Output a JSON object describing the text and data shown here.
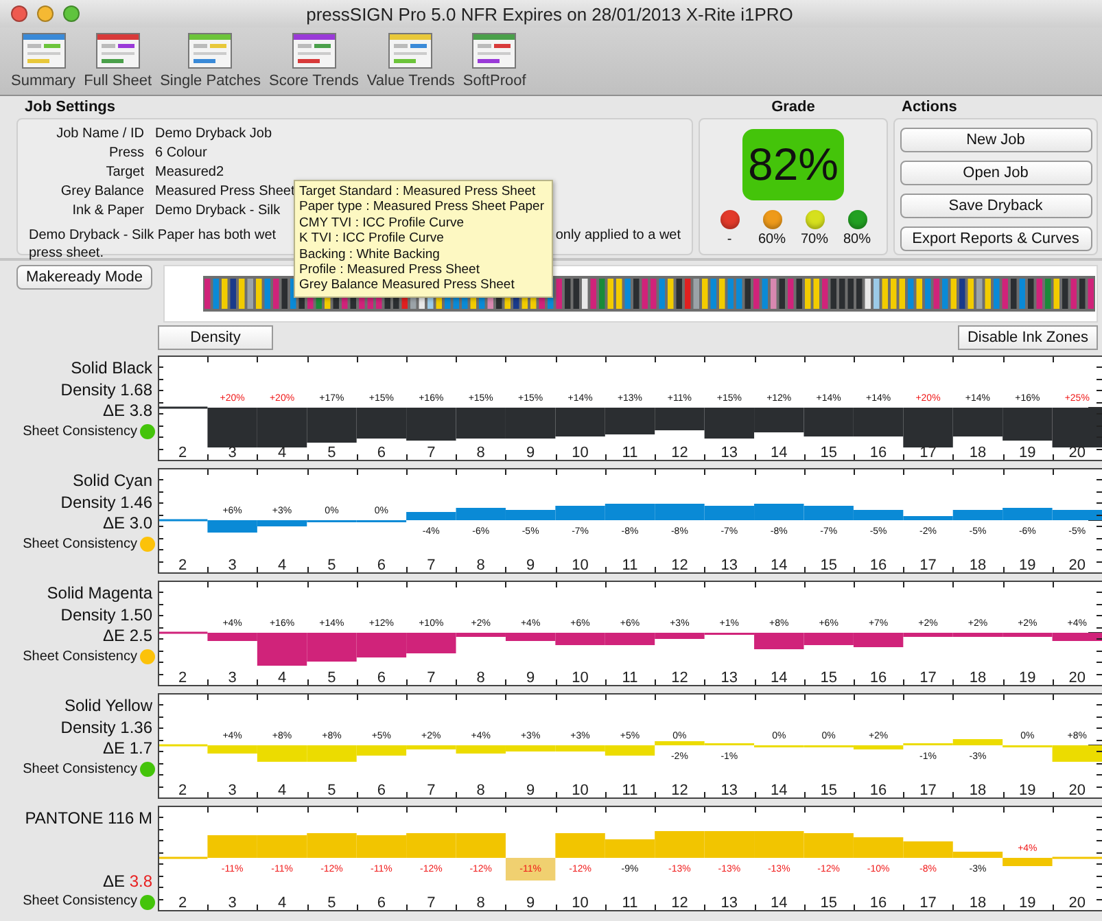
{
  "window": {
    "title": "pressSIGN Pro 5.0 NFR Expires on 28/01/2013 X-Rite i1PRO"
  },
  "toolbar": [
    {
      "label": "Summary"
    },
    {
      "label": "Full Sheet"
    },
    {
      "label": "Single Patches"
    },
    {
      "label": "Score Trends"
    },
    {
      "label": "Value Trends"
    },
    {
      "label": "SoftProof"
    }
  ],
  "job_settings": {
    "title": "Job Settings",
    "fields": [
      {
        "label": "Job Name / ID",
        "value": "Demo Dryback Job"
      },
      {
        "label": "Press",
        "value": "6 Colour"
      },
      {
        "label": "Target",
        "value": "Measured2"
      },
      {
        "label": "Grey Balance",
        "value": "Measured Press Sheet"
      },
      {
        "label": "Ink & Paper",
        "value": "Demo Dryback - Silk"
      }
    ],
    "note_start": "Demo Dryback - Silk Paper has both wet",
    "note_end": "only applied to a wet",
    "note_line2": "press sheet."
  },
  "tooltip": {
    "lines": [
      "Target Standard : Measured Press Sheet",
      "Paper type : Measured Press Sheet Paper",
      "CMY TVI : ICC Profile Curve",
      "K TVI : ICC Profile Curve",
      "Backing : White Backing",
      "Profile : Measured Press Sheet",
      "Grey Balance Measured Press Sheet"
    ]
  },
  "grade": {
    "title": "Grade",
    "score": "82%",
    "levels": [
      {
        "label": "-",
        "color": "#e23a2a"
      },
      {
        "label": "60%",
        "color": "#ee9a1a"
      },
      {
        "label": "70%",
        "color": "#d6e01e"
      },
      {
        "label": "80%",
        "color": "#22a022"
      }
    ]
  },
  "actions": {
    "title": "Actions",
    "buttons": [
      "New Job",
      "Open Job",
      "Save Dryback",
      "Export Reports & Curves"
    ]
  },
  "makeready_button": "Makeready Mode",
  "density_button": "Density",
  "ink_zones_button": "Disable Ink Zones",
  "charts": [
    {
      "name": "Solid Black",
      "density": "Density 1.68",
      "delta_e_label": "ΔE",
      "delta_e": "3.8",
      "delta_e_alert": false,
      "consistency": {
        "label": "Sheet Consistency",
        "color": "#44c40a"
      },
      "color": "#2b2e31",
      "axis": [
        "2",
        "3",
        "4",
        "5",
        "6",
        "7",
        "8",
        "9",
        "10",
        "11",
        "12",
        "13",
        "14",
        "15",
        "16",
        "17",
        "18",
        "19",
        "20"
      ],
      "bars": [
        {
          "above": "+20%",
          "alert": true
        },
        {
          "above": "+20%",
          "alert": true
        },
        {
          "above": "+17%",
          "alert": false
        },
        {
          "above": "+15%",
          "alert": false
        },
        {
          "above": "+16%",
          "alert": false
        },
        {
          "above": "+15%",
          "alert": false
        },
        {
          "above": "+15%",
          "alert": false
        },
        {
          "above": "+14%",
          "alert": false
        },
        {
          "above": "+13%",
          "alert": false
        },
        {
          "above": "+11%",
          "alert": false
        },
        {
          "above": "+15%",
          "alert": false
        },
        {
          "above": "+12%",
          "alert": false
        },
        {
          "above": "+14%",
          "alert": false
        },
        {
          "above": "+14%",
          "alert": false
        },
        {
          "above": "+20%",
          "alert": true
        },
        {
          "above": "+14%",
          "alert": false
        },
        {
          "above": "+16%",
          "alert": false
        },
        {
          "above": "+25%",
          "alert": true
        }
      ]
    },
    {
      "name": "Solid Cyan",
      "density": "Density 1.46",
      "delta_e_label": "ΔE",
      "delta_e": "3.0",
      "delta_e_alert": false,
      "consistency": {
        "label": "Sheet Consistency",
        "color": "#fcc20a"
      },
      "color": "#0a8ad6",
      "axis": [
        "2",
        "3",
        "4",
        "5",
        "6",
        "7",
        "8",
        "9",
        "10",
        "11",
        "12",
        "13",
        "14",
        "15",
        "16",
        "17",
        "18",
        "19",
        "20"
      ],
      "bars": [
        {
          "above": "+6%",
          "alert": false
        },
        {
          "above": "+3%",
          "alert": false
        },
        {
          "above": "0%",
          "alert": false
        },
        {
          "above": "0%",
          "alert": false
        },
        {
          "below": "-4%",
          "alert": false
        },
        {
          "below": "-6%",
          "alert": false
        },
        {
          "below": "-5%",
          "alert": false
        },
        {
          "below": "-7%",
          "alert": false
        },
        {
          "below": "-8%",
          "alert": false
        },
        {
          "below": "-8%",
          "alert": false
        },
        {
          "below": "-7%",
          "alert": false
        },
        {
          "below": "-8%",
          "alert": false
        },
        {
          "below": "-7%",
          "alert": false
        },
        {
          "below": "-5%",
          "alert": false
        },
        {
          "below": "-2%",
          "alert": false
        },
        {
          "below": "-5%",
          "alert": false
        },
        {
          "below": "-6%",
          "alert": false
        },
        {
          "below": "-5%",
          "alert": false
        }
      ]
    },
    {
      "name": "Solid Magenta",
      "density": "Density 1.50",
      "delta_e_label": "ΔE",
      "delta_e": "2.5",
      "delta_e_alert": false,
      "consistency": {
        "label": "Sheet Consistency",
        "color": "#fcc20a"
      },
      "color": "#d0237a",
      "axis": [
        "2",
        "3",
        "4",
        "5",
        "6",
        "7",
        "8",
        "9",
        "10",
        "11",
        "12",
        "13",
        "14",
        "15",
        "16",
        "17",
        "18",
        "19",
        "20"
      ],
      "bars": [
        {
          "above": "+4%",
          "alert": false
        },
        {
          "above": "+16%",
          "alert": false
        },
        {
          "above": "+14%",
          "alert": false
        },
        {
          "above": "+12%",
          "alert": false
        },
        {
          "above": "+10%",
          "alert": false
        },
        {
          "above": "+2%",
          "alert": false
        },
        {
          "above": "+4%",
          "alert": false
        },
        {
          "above": "+6%",
          "alert": false
        },
        {
          "above": "+6%",
          "alert": false
        },
        {
          "above": "+3%",
          "alert": false
        },
        {
          "above": "+1%",
          "alert": false
        },
        {
          "above": "+8%",
          "alert": false
        },
        {
          "above": "+6%",
          "alert": false
        },
        {
          "above": "+7%",
          "alert": false
        },
        {
          "above": "+2%",
          "alert": false
        },
        {
          "above": "+2%",
          "alert": false
        },
        {
          "above": "+2%",
          "alert": false
        },
        {
          "above": "+4%",
          "alert": false
        }
      ]
    },
    {
      "name": "Solid Yellow",
      "density": "Density 1.36",
      "delta_e_label": "ΔE",
      "delta_e": "1.7",
      "delta_e_alert": false,
      "consistency": {
        "label": "Sheet Consistency",
        "color": "#44c40a"
      },
      "color": "#ecdc00",
      "axis": [
        "2",
        "3",
        "4",
        "5",
        "6",
        "7",
        "8",
        "9",
        "10",
        "11",
        "12",
        "13",
        "14",
        "15",
        "16",
        "17",
        "18",
        "19",
        "20"
      ],
      "bars": [
        {
          "above": "+4%",
          "alert": false
        },
        {
          "above": "+8%",
          "alert": false
        },
        {
          "above": "+8%",
          "alert": false
        },
        {
          "above": "+5%",
          "alert": false
        },
        {
          "above": "+2%",
          "alert": false
        },
        {
          "above": "+4%",
          "alert": false
        },
        {
          "above": "+3%",
          "alert": false
        },
        {
          "above": "+3%",
          "alert": false
        },
        {
          "above": "+5%",
          "alert": false
        },
        {
          "above": "0%",
          "below": "-2%",
          "alert": false
        },
        {
          "below": "-1%",
          "alert": false
        },
        {
          "above": "0%",
          "alert": false
        },
        {
          "above": "0%",
          "alert": false
        },
        {
          "above": "+2%",
          "alert": false
        },
        {
          "below": "-1%",
          "alert": false
        },
        {
          "below": "-3%",
          "alert": false
        },
        {
          "above": "0%",
          "alert": false
        },
        {
          "above": "+8%",
          "alert": false
        }
      ]
    },
    {
      "name": "PANTONE 116 M",
      "delta_e_label": "ΔE",
      "delta_e": "3.8",
      "delta_e_alert": true,
      "consistency": {
        "label": "Sheet Consistency",
        "color": "#44c40a"
      },
      "color": "#f2c500",
      "axis": [
        "2",
        "3",
        "4",
        "5",
        "6",
        "7",
        "8",
        "9",
        "10",
        "11",
        "12",
        "13",
        "14",
        "15",
        "16",
        "17",
        "18",
        "19",
        "20"
      ],
      "bars": [
        {
          "below": "-11%",
          "alert": true,
          "highlighted": false
        },
        {
          "below": "-11%",
          "alert": true,
          "highlighted": false
        },
        {
          "below": "-12%",
          "alert": true,
          "highlighted": false
        },
        {
          "below": "-11%",
          "alert": true,
          "highlighted": false
        },
        {
          "below": "-12%",
          "alert": true,
          "highlighted": false
        },
        {
          "below": "-12%",
          "alert": true,
          "highlighted": false
        },
        {
          "below": "-11%",
          "alert": true,
          "highlighted": true
        },
        {
          "below": "-12%",
          "alert": true,
          "highlighted": false
        },
        {
          "below": "-9%",
          "alert": false,
          "highlighted": false
        },
        {
          "below": "-13%",
          "alert": true,
          "highlighted": false
        },
        {
          "below": "-13%",
          "alert": true,
          "highlighted": false
        },
        {
          "below": "-13%",
          "alert": true,
          "highlighted": false
        },
        {
          "below": "-12%",
          "alert": true,
          "highlighted": false
        },
        {
          "below": "-10%",
          "alert": true,
          "highlighted": false
        },
        {
          "below": "-8%",
          "alert": true,
          "highlighted": false
        },
        {
          "below": "-3%",
          "alert": false,
          "highlighted": false
        },
        {
          "above": "+4%",
          "alert": true,
          "highlighted": false
        }
      ]
    }
  ]
}
